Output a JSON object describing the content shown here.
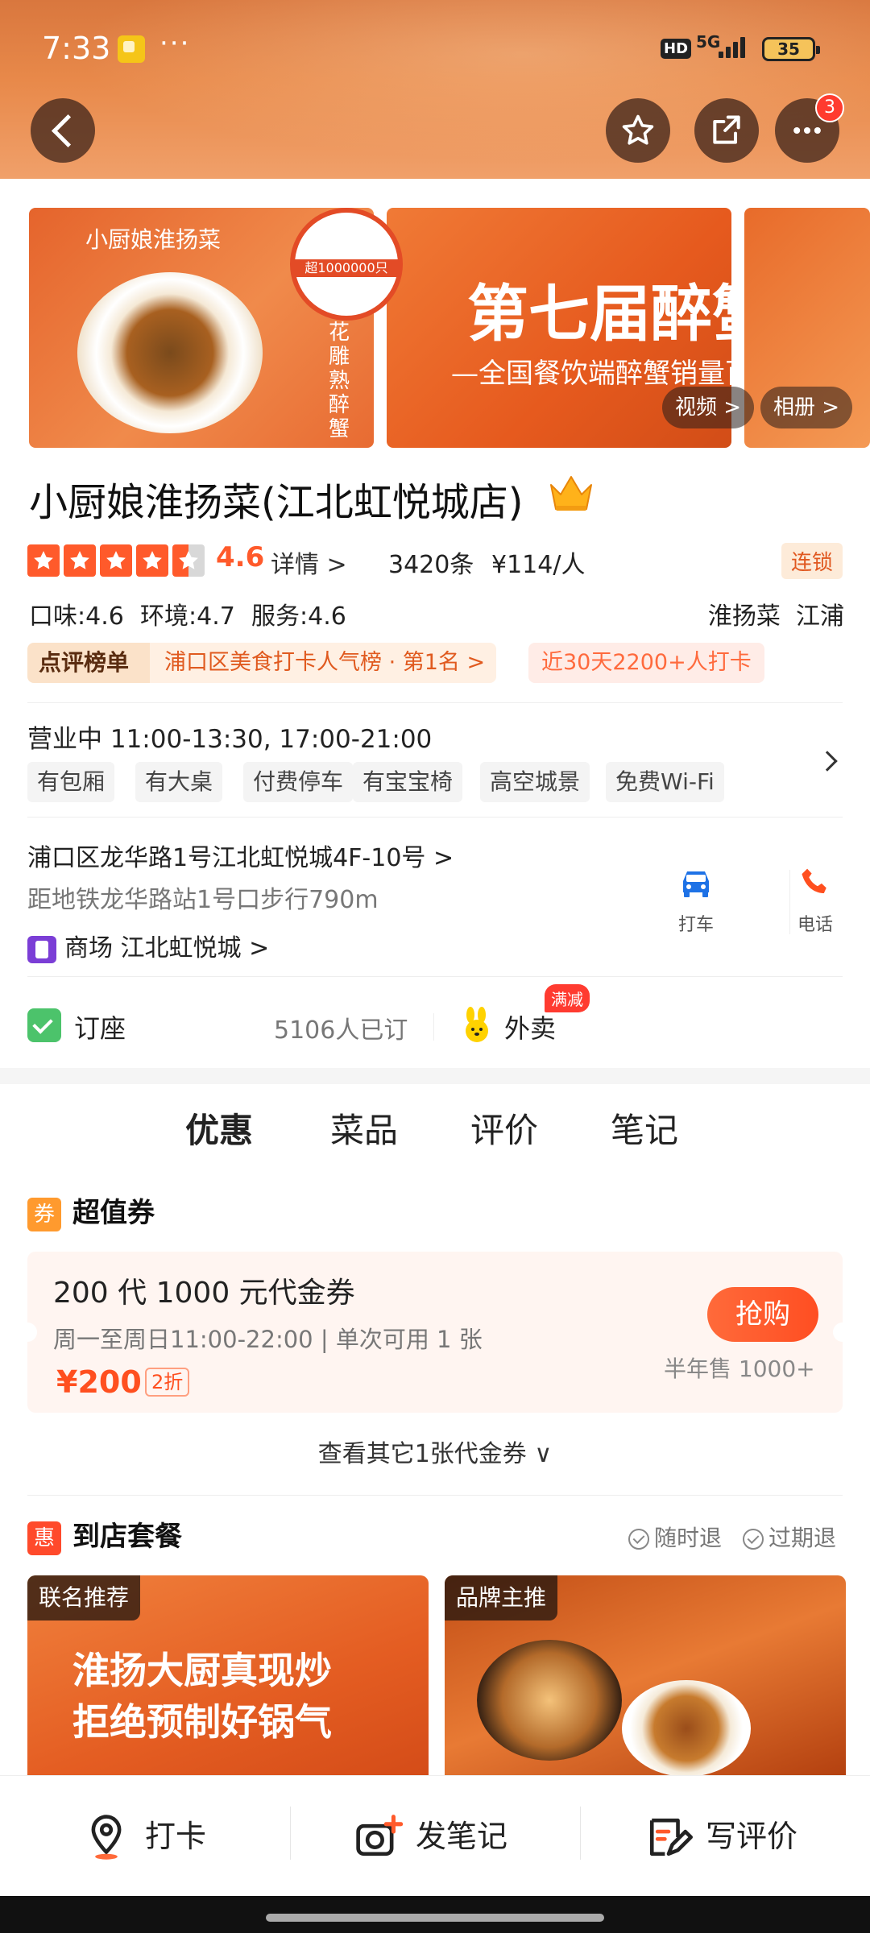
{
  "status_bar": {
    "time": "7:33",
    "dots": "···",
    "hd": "HD",
    "network": "5G",
    "battery": "35"
  },
  "header": {
    "more_badge": "3"
  },
  "gallery": {
    "img1_logo": "小厨娘淮扬菜",
    "img1_side": "陈年花雕熟醉蟹",
    "img1_stamp": "超1000000只",
    "img2_title": "第七届醉蟹",
    "img2_sub": "—全国餐饮端醉蟹销量百万",
    "video_label": "视频 >",
    "album_label": "相册 >"
  },
  "shop": {
    "name": "小厨娘淮扬菜(江北虹悦城店)",
    "score": "4.6",
    "detail": "详情 >",
    "review_count": "3420条",
    "avg_price": "¥114/人",
    "chain": "连锁",
    "taste": "口味:4.6",
    "environment": "环境:4.7",
    "service": "服务:4.6",
    "cuisine": "淮扬菜",
    "area": "江浦",
    "rank_label": "点评榜单",
    "rank_text": "浦口区美食打卡人气榜 · 第1名 >",
    "checkin": "近30天2200+人打卡",
    "hours": "营业中  11:00-13:30, 17:00-21:00",
    "facilities": [
      "有包厢",
      "有大桌",
      "付费停车",
      "有宝宝椅",
      "高空城景",
      "免费Wi-Fi"
    ],
    "address": "浦口区龙华路1号江北虹悦城4F-10号 >",
    "metro": "距地铁龙华路站1号口步行790m",
    "mall": "商场  江北虹悦城 >",
    "taxi": "打车",
    "phone": "电话",
    "booking": "订座",
    "booking_count": "5106人已订",
    "takeout": "外卖",
    "takeout_badge": "满减"
  },
  "tabs": [
    {
      "label": "优惠",
      "active": true
    },
    {
      "label": "菜品",
      "active": false
    },
    {
      "label": "评价",
      "active": false
    },
    {
      "label": "笔记",
      "active": false
    }
  ],
  "coupons": {
    "section_icon": "券",
    "section_title": "超值券",
    "title": "200 代 1000 元代金券",
    "time": "周一至周日11:00-22:00 | 单次可用 1 张",
    "price": "¥200",
    "discount": "2折",
    "buy": "抢购",
    "sold": "半年售 1000+",
    "more": "查看其它1张代金券 ∨"
  },
  "packages": {
    "section_icon": "惠",
    "section_title": "到店套餐",
    "refund_anytime": "随时退",
    "refund_expired": "过期退",
    "card1_tag": "联名推荐",
    "card1_text": "淮扬大厨真现炒\n拒绝预制好锅气",
    "card2_tag": "品牌主推"
  },
  "bottom_bar": {
    "checkin": "打卡",
    "post_note": "发笔记",
    "write_review": "写评价"
  },
  "colors": {
    "accent": "#ff5a2b",
    "header": "#e8894a"
  }
}
